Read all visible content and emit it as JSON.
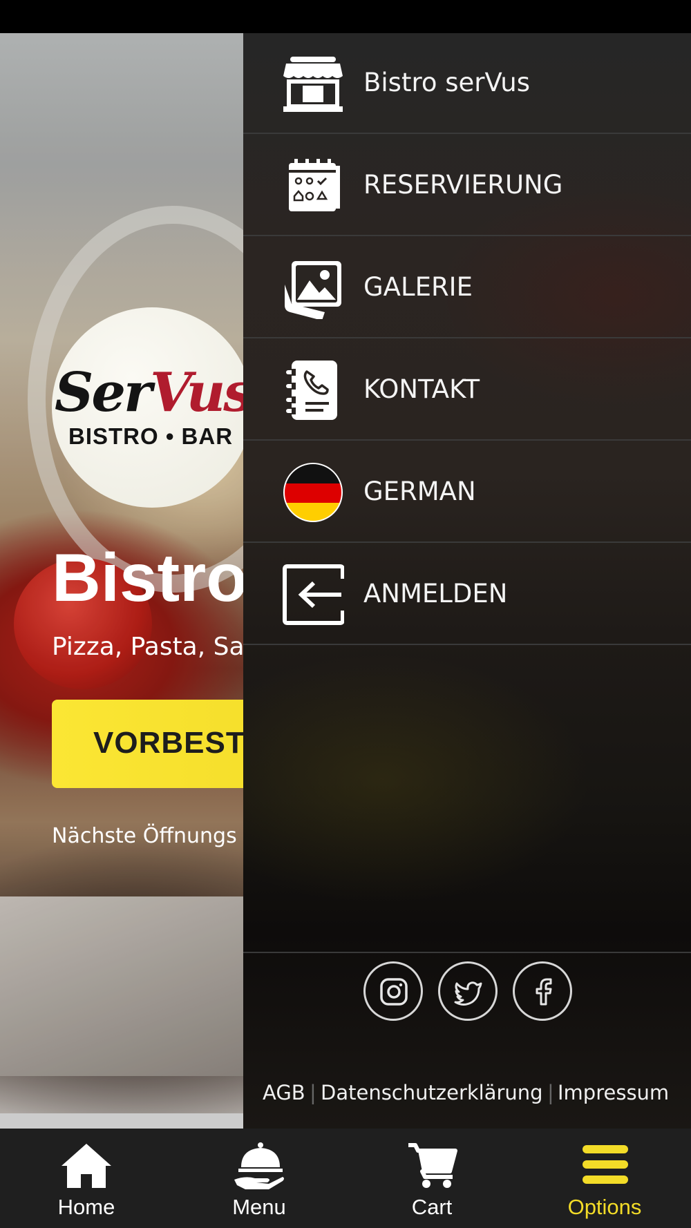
{
  "background": {
    "logo": {
      "script_text": "SerVus",
      "script_black": "Ser",
      "script_red": "Vus",
      "subtext": "BISTRO • BAR"
    },
    "title": "Bistro",
    "subtitle": "Pizza, Pasta, Sa",
    "order_button_label": "VORBESTE",
    "note": "Nächste Öffnungs"
  },
  "drawer": {
    "items": [
      {
        "label": "Bistro serVus",
        "icon": "store-icon"
      },
      {
        "label": "RESERVIERUNG",
        "icon": "calendar-icon"
      },
      {
        "label": "GALERIE",
        "icon": "gallery-icon"
      },
      {
        "label": "KONTAKT",
        "icon": "contact-book-icon"
      },
      {
        "label": "GERMAN",
        "icon": "german-flag-icon"
      },
      {
        "label": "ANMELDEN",
        "icon": "login-icon"
      }
    ],
    "social": [
      {
        "name": "instagram-icon"
      },
      {
        "name": "twitter-icon"
      },
      {
        "name": "facebook-icon"
      }
    ],
    "legal": {
      "agb": "AGB",
      "privacy": "Datenschutzerklärung",
      "imprint": "Impressum"
    }
  },
  "tab_bar": {
    "tabs": [
      {
        "label": "Home",
        "icon": "home-icon"
      },
      {
        "label": "Menu",
        "icon": "cloche-icon"
      },
      {
        "label": "Cart",
        "icon": "cart-icon"
      },
      {
        "label": "Options",
        "icon": "hamburger-icon",
        "active": true
      }
    ]
  },
  "colors": {
    "accent": "#f3dc28",
    "drawer_bg": "#262626",
    "tab_bar_bg": "#1f1f1f",
    "logo_red": "#b01c2e"
  }
}
